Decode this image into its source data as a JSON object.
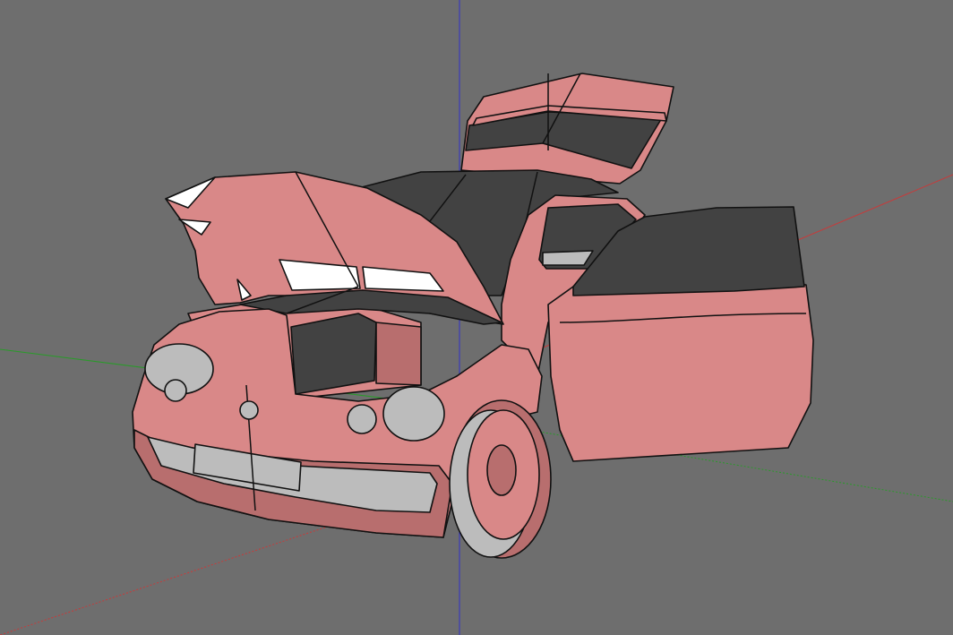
{
  "viewport": {
    "background_color": "#6e6e6e",
    "axes": {
      "x_color": "#c83a3a",
      "y_color": "#2a9a2a",
      "z_color": "#3030c8"
    },
    "model": {
      "name": "car",
      "body_color": "#d98888",
      "body_shadow_color": "#b86e6e",
      "window_color": "#424242",
      "trim_color": "#bcbcbc",
      "outline_color": "#111111",
      "state": {
        "hood": "open",
        "trunk": "open",
        "driver_door": "open"
      }
    }
  }
}
